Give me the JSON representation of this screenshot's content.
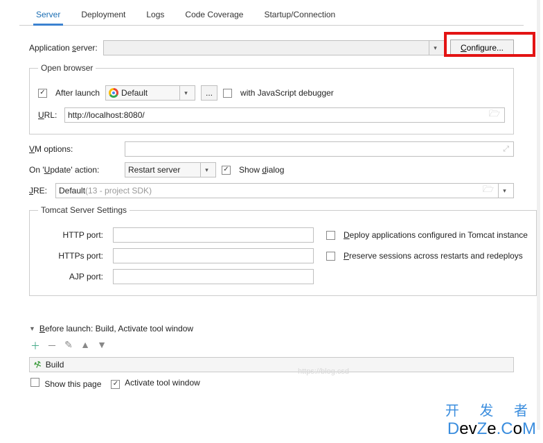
{
  "tabs": {
    "server": "Server",
    "deployment": "Deployment",
    "logs": "Logs",
    "coverage": "Code Coverage",
    "startup": "Startup/Connection"
  },
  "appServer": {
    "label_pre": "Application ",
    "label_u": "s",
    "label_post": "erver:",
    "configure": "Configure..."
  },
  "openBrowser": {
    "legend": "Open browser",
    "afterLaunch": "After launch",
    "defaultBrowser": "Default",
    "ellipsis": "...",
    "withJsDebugger": "with JavaScript debugger",
    "urlLabel_u": "U",
    "urlLabel_post": "RL:",
    "urlValue": "http://localhost:8080/"
  },
  "vmOptions": {
    "label_u": "V",
    "label_post": "M options:"
  },
  "updateAction": {
    "label_pre": "On '",
    "label_u": "U",
    "label_mid": "pdate' action:",
    "value": "Restart server",
    "showDialog_pre": "Show ",
    "showDialog_u": "d",
    "showDialog_post": "ialog"
  },
  "jre": {
    "label_u": "J",
    "label_post": "RE:",
    "value_pre": "Default ",
    "value_grey": "(13 - project SDK)"
  },
  "tomcat": {
    "legend": "Tomcat Server Settings",
    "httpPort": "HTTP port:",
    "httpsPort": "HTTPs port:",
    "ajpPort": "AJP port:",
    "deploy_u": "D",
    "deploy_post": "eploy applications configured in Tomcat instance",
    "preserve_u": "P",
    "preserve_post": "reserve sessions across restarts and redeploys"
  },
  "before": {
    "header_u": "B",
    "header_post": "efore launch: Build, Activate tool window",
    "build": "Build",
    "showThisPage": "Show this page",
    "activateToolWindow": "Activate tool window"
  },
  "watermark": {
    "url": "https://blog.csd",
    "cn": "开 发 者",
    "en_pre": "D",
    "en_mid": "ev",
    "en_z": "Z",
    "en_e": "e",
    "en_dot": ".",
    "en_c": "C",
    "en_o": "o",
    "en_m": "M"
  }
}
